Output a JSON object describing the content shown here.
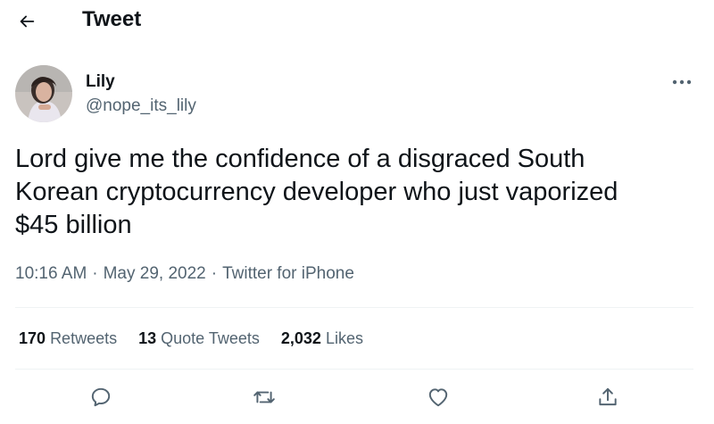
{
  "header": {
    "title": "Tweet",
    "back_icon": "arrow-left-icon"
  },
  "author": {
    "name": "Lily",
    "handle": "@nope_its_lily",
    "avatar": "avatar-photo"
  },
  "tweet": {
    "text": "Lord give me the confidence of a disgraced South\nKorean cryptocurrency developer who just vaporized\n$45 billion",
    "time": "10:16 AM",
    "date": "May 29, 2022",
    "separator": "·",
    "source": "Twitter for iPhone"
  },
  "stats": {
    "retweets_count": "170",
    "retweets_label": "Retweets",
    "quotes_count": "13",
    "quotes_label": "Quote Tweets",
    "likes_count": "2,032",
    "likes_label": "Likes"
  },
  "actions": [
    {
      "icon": "reply-icon"
    },
    {
      "icon": "retweet-icon"
    },
    {
      "icon": "like-icon"
    },
    {
      "icon": "share-icon"
    }
  ],
  "colors": {
    "text": "#0f1419",
    "secondary": "#536471",
    "divider": "#eff3f4"
  }
}
